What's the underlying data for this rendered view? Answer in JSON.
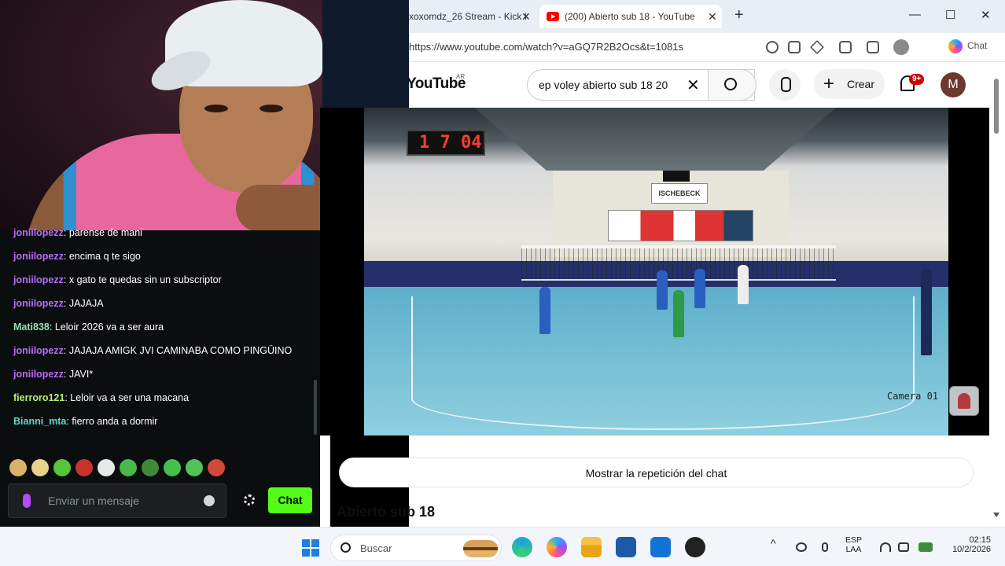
{
  "chat": {
    "messages": [
      {
        "user": "joniilopezz",
        "text": "parense de mani",
        "color": "#b86cf5"
      },
      {
        "user": "joniilopezz",
        "text": "encima q te sigo",
        "color": "#b86cf5"
      },
      {
        "user": "joniilopezz",
        "text": "x gato te quedas sin un subscriptor",
        "color": "#b86cf5"
      },
      {
        "user": "joniilopezz",
        "text": "JAJAJA",
        "color": "#b86cf5"
      },
      {
        "user": "Mati838",
        "text": "Leloir 2026 va a ser aura",
        "color": "#8ee5a9"
      },
      {
        "user": "joniilopezz",
        "text": "JAJAJA AMIGK JVI CAMINABA COMO PINGÜINO",
        "color": "#b86cf5"
      },
      {
        "user": "joniilopezz",
        "text": "JAVI*",
        "color": "#b86cf5"
      },
      {
        "user": "fierroro121",
        "text": "Leloir va a ser una macana",
        "color": "#b7f06a"
      },
      {
        "user": "Bianni_mta",
        "text": "fierro anda a dormir",
        "color": "#5fd6c7"
      }
    ],
    "input_placeholder": "Enviar un mensaje",
    "send_label": "Chat",
    "emotes": [
      "cat-emote",
      "doge-emote",
      "kick-green-emote",
      "angry-emote",
      "ghost-emote",
      "pepe-emote",
      "pepe-clown-emote",
      "pepe-smile-emote",
      "pepe-sad-emote",
      "pepe-cap-emote"
    ]
  },
  "browser": {
    "tabs": [
      {
        "title": "xoxomdz_26 Stream - Kick I",
        "active": false
      },
      {
        "title": "(200) Abierto sub 18 - YouTube",
        "active": true
      }
    ],
    "url": "https://www.youtube.com/watch?v=aGQ7R2B2Ocs&t=1081s",
    "copilot_label": "Chat"
  },
  "youtube": {
    "logo": "YouTube",
    "region": "AR",
    "search_query": "ep voley abierto sub 18 20",
    "create_label": "Crear",
    "notification_badge": "9+",
    "avatar_letter": "M",
    "replay_chat_label": "Mostrar la repetición del chat",
    "video_title": "Abierto sub 18"
  },
  "video": {
    "scoreboard": "1 7 04",
    "camera_label": "Camera 01",
    "banner_text": "ISCHEBECK"
  },
  "taskbar": {
    "search_placeholder": "Buscar",
    "language": "ESP",
    "layout": "LAA",
    "time": "02:15",
    "date": "10/2/2026"
  }
}
